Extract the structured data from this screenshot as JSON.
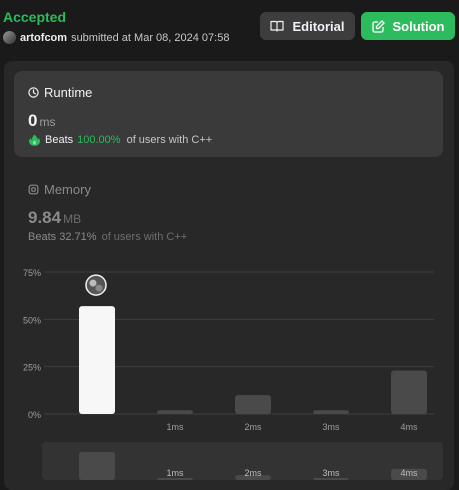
{
  "header": {
    "status": "Accepted",
    "user": "artofcom",
    "submitted_text": "submitted at Mar 08, 2024 07:58",
    "editorial_label": "Editorial",
    "solution_label": "Solution"
  },
  "runtime": {
    "title": "Runtime",
    "value": "0",
    "unit": "ms",
    "beats_label": "Beats",
    "beats_pct": "100.00%",
    "beats_suffix": "of users with C++"
  },
  "memory": {
    "title": "Memory",
    "value": "9.84",
    "unit": "MB",
    "beats_label": "Beats",
    "beats_pct": "32.71%",
    "beats_suffix": "of users with C++"
  },
  "colors": {
    "accent_green": "#2cbb5d",
    "bar_highlight": "#f7f7f7",
    "bar_normal": "#4a4a4a"
  },
  "chart_data": {
    "type": "bar",
    "categories": [
      "",
      "1ms",
      "2ms",
      "3ms",
      "4ms"
    ],
    "values": [
      57,
      2,
      10,
      2,
      23
    ],
    "yticks": [
      "0%",
      "25%",
      "50%",
      "75%"
    ],
    "ylim": [
      0,
      75
    ],
    "highlight_index": 0,
    "grid": true
  }
}
